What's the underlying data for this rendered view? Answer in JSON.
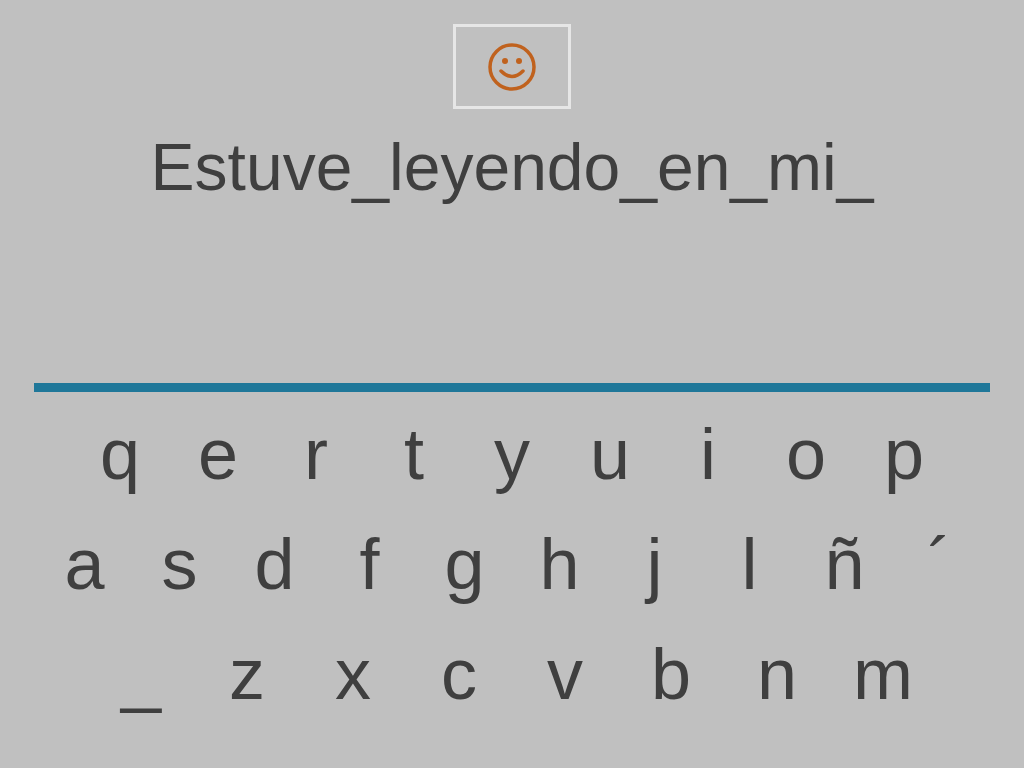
{
  "sentence": "Estuve_leyendo_en_mi_",
  "keyboard": {
    "rows": [
      [
        "q",
        "e",
        "r",
        "t",
        "y",
        "u",
        "i",
        "o",
        "p"
      ],
      [
        "a",
        "s",
        "d",
        "f",
        "g",
        "h",
        "j",
        "l",
        "ñ",
        "´"
      ],
      [
        "_",
        "z",
        "x",
        "c",
        "v",
        "b",
        "n",
        "m"
      ]
    ]
  }
}
